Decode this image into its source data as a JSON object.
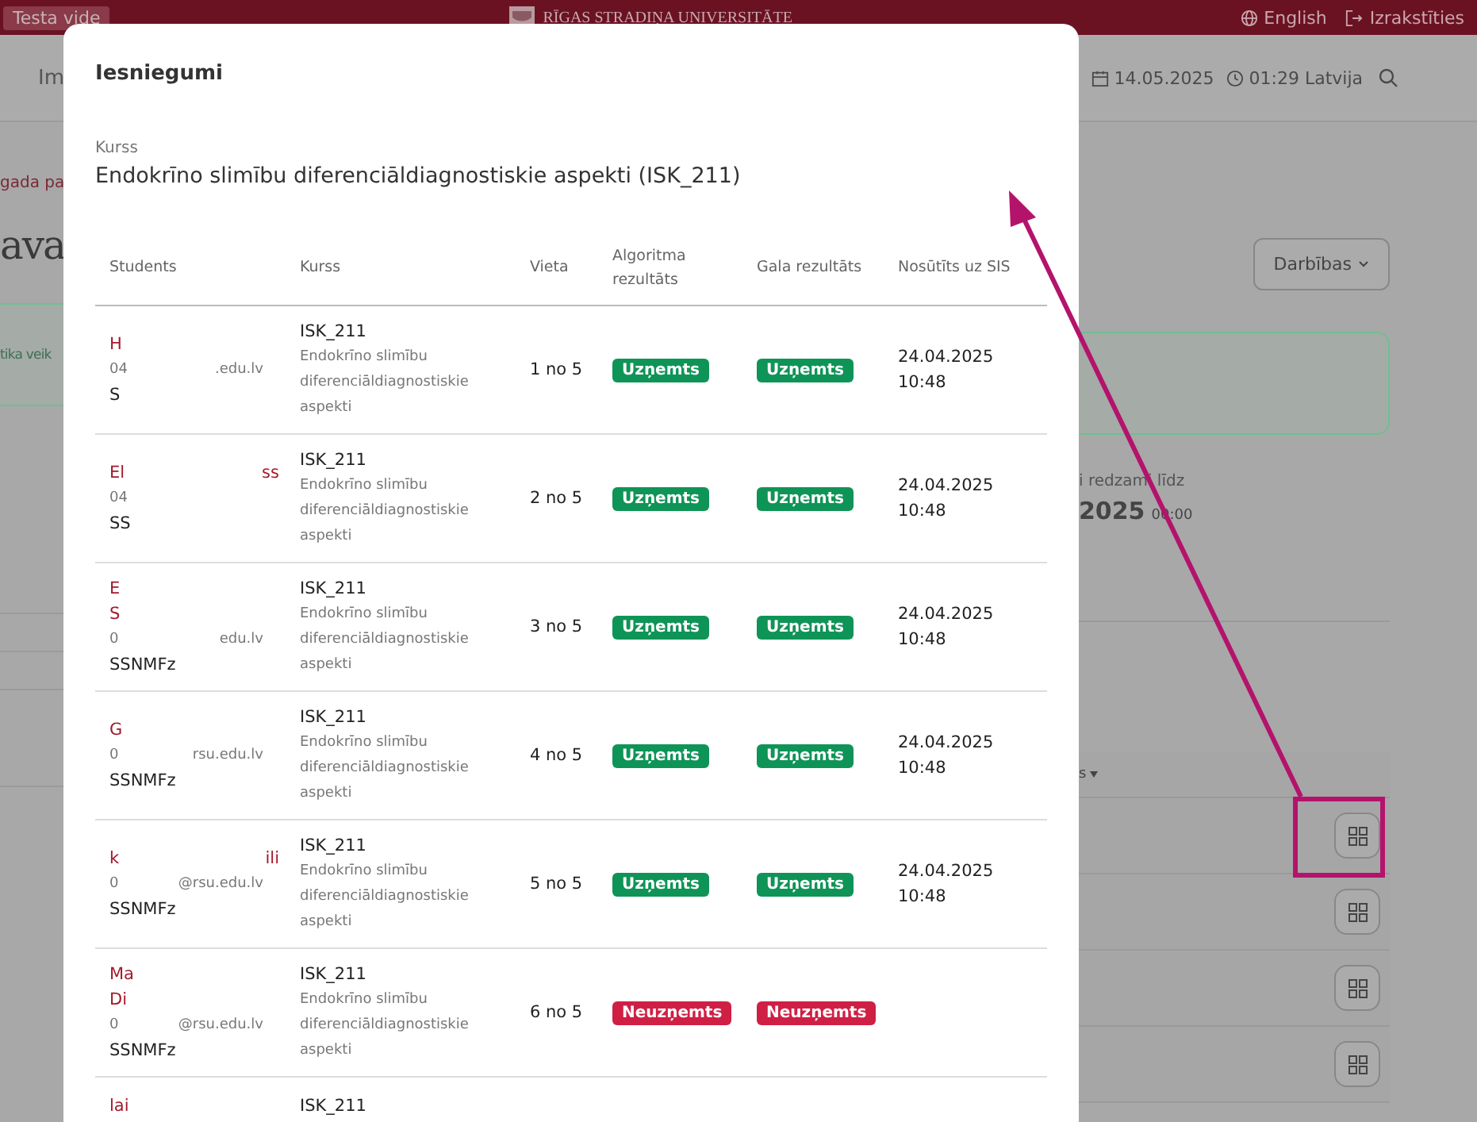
{
  "topbar": {
    "environment_badge": "Testa vide",
    "logo_lines": [
      "RĪGAS STRADIŅA",
      "UNIVERSITĀTE"
    ],
    "language": "English",
    "logout": "Izrakstīties"
  },
  "header": {
    "title_fragment": "Im",
    "date": "14.05.2025",
    "time": "01:29 Latvija"
  },
  "background_left": {
    "link_fragment": "gada pa",
    "heading_fragment": "ava",
    "alert_fragment": "tika veik"
  },
  "background_right": {
    "actions_button": "Darbības",
    "visible_until_label": "i redzami līdz",
    "visible_until_date": "2025",
    "visible_until_time": "00:00",
    "table_header_fragment": "s",
    "row_buttons": [
      {
        "highlighted": true
      },
      {
        "highlighted": false
      },
      {
        "highlighted": false
      },
      {
        "highlighted": false
      }
    ]
  },
  "modal": {
    "title": "Iesniegumi",
    "course_label": "Kurss",
    "course_title": "Endokrīno slimību diferenciāldiagnostiskie aspekti (ISK_211)",
    "columns": [
      "Students",
      "Kurss",
      "Vieta",
      "Algoritma rezultāts",
      "Gala rezultāts",
      "Nosūtīts uz SIS"
    ],
    "rows": [
      {
        "student": {
          "name_lines": [
            [
              "H"
            ]
          ],
          "email": [
            "04",
            ".edu.lv"
          ],
          "faculty": "S"
        },
        "course_code": "ISK_211",
        "course_name": "Endokrīno slimību diferenciāldiagnostiskie aspekti",
        "place": "1 no 5",
        "algorithm_result": {
          "label": "Uzņemts",
          "color": "#0f9457"
        },
        "final_result": {
          "label": "Uzņemts",
          "color": "#0f9457"
        },
        "sent_date": "24.04.2025",
        "sent_time": "10:48"
      },
      {
        "student": {
          "name_lines": [
            [
              "El",
              "ss"
            ]
          ],
          "email": [
            "04"
          ],
          "faculty": "SS"
        },
        "course_code": "ISK_211",
        "course_name": "Endokrīno slimību diferenciāldiagnostiskie aspekti",
        "place": "2 no 5",
        "algorithm_result": {
          "label": "Uzņemts",
          "color": "#0f9457"
        },
        "final_result": {
          "label": "Uzņemts",
          "color": "#0f9457"
        },
        "sent_date": "24.04.2025",
        "sent_time": "10:48"
      },
      {
        "student": {
          "name_lines": [
            [
              "E"
            ],
            [
              "S"
            ]
          ],
          "email": [
            "0",
            "edu.lv"
          ],
          "faculty": "SSNMFz"
        },
        "course_code": "ISK_211",
        "course_name": "Endokrīno slimību diferenciāldiagnostiskie aspekti",
        "place": "3 no 5",
        "algorithm_result": {
          "label": "Uzņemts",
          "color": "#0f9457"
        },
        "final_result": {
          "label": "Uzņemts",
          "color": "#0f9457"
        },
        "sent_date": "24.04.2025",
        "sent_time": "10:48"
      },
      {
        "student": {
          "name_lines": [
            [
              "G"
            ]
          ],
          "email": [
            "0",
            "rsu.edu.lv"
          ],
          "faculty": "SSNMFz"
        },
        "course_code": "ISK_211",
        "course_name": "Endokrīno slimību diferenciāldiagnostiskie aspekti",
        "place": "4 no 5",
        "algorithm_result": {
          "label": "Uzņemts",
          "color": "#0f9457"
        },
        "final_result": {
          "label": "Uzņemts",
          "color": "#0f9457"
        },
        "sent_date": "24.04.2025",
        "sent_time": "10:48"
      },
      {
        "student": {
          "name_lines": [
            [
              "k",
              "ili"
            ]
          ],
          "email": [
            "0",
            "@rsu.edu.lv"
          ],
          "faculty": "SSNMFz"
        },
        "course_code": "ISK_211",
        "course_name": "Endokrīno slimību diferenciāldiagnostiskie aspekti",
        "place": "5 no 5",
        "algorithm_result": {
          "label": "Uzņemts",
          "color": "#0f9457"
        },
        "final_result": {
          "label": "Uzņemts",
          "color": "#0f9457"
        },
        "sent_date": "24.04.2025",
        "sent_time": "10:48"
      },
      {
        "student": {
          "name_lines": [
            [
              "Ma"
            ],
            [
              "Di"
            ]
          ],
          "email": [
            "0",
            "@rsu.edu.lv"
          ],
          "faculty": "SSNMFz"
        },
        "course_code": "ISK_211",
        "course_name": "Endokrīno slimību diferenciāldiagnostiskie aspekti",
        "place": "6 no 5",
        "algorithm_result": {
          "label": "Neuzņemts",
          "color": "#d01f45"
        },
        "final_result": {
          "label": "Neuzņemts",
          "color": "#d01f45"
        }
      },
      {
        "student": {
          "name_lines": [
            [
              "lai"
            ]
          ]
        },
        "course_code": "ISK_211"
      }
    ]
  }
}
